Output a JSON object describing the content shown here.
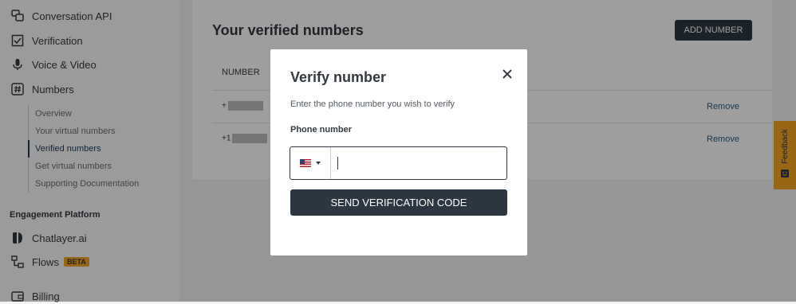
{
  "sidebar": {
    "items": [
      {
        "label": "Conversation API",
        "icon": "chat-bubbles-icon"
      },
      {
        "label": "Verification",
        "icon": "checkbox-icon"
      },
      {
        "label": "Voice & Video",
        "icon": "microphone-icon"
      },
      {
        "label": "Numbers",
        "icon": "hashtag-icon"
      }
    ],
    "sub_items": [
      {
        "label": "Overview"
      },
      {
        "label": "Your virtual numbers"
      },
      {
        "label": "Verified numbers"
      },
      {
        "label": "Get virtual numbers"
      },
      {
        "label": "Supporting Documentation"
      }
    ],
    "section_heading": "Engagement Platform",
    "platform_items": [
      {
        "label": "Chatlayer.ai",
        "icon": "chatlayer-icon"
      },
      {
        "label": "Flows",
        "icon": "flows-icon",
        "badge": "BETA"
      },
      {
        "label": "Billing",
        "icon": "wallet-icon"
      }
    ]
  },
  "main": {
    "title": "Your verified numbers",
    "add_button": "ADD NUMBER",
    "column_header": "NUMBER",
    "rows": [
      {
        "number_prefix": "+",
        "action": "Remove"
      },
      {
        "number_prefix": "+1",
        "action": "Remove"
      }
    ]
  },
  "feedback": {
    "label": "Feedback"
  },
  "modal": {
    "title": "Verify number",
    "description": "Enter the phone number you wish to verify",
    "field_label": "Phone number",
    "country": "US",
    "phone_value": "",
    "submit": "SEND VERIFICATION CODE"
  },
  "colors": {
    "primary_dark": "#2d3741",
    "accent": "#f5a623",
    "link": "#2a5d84"
  }
}
